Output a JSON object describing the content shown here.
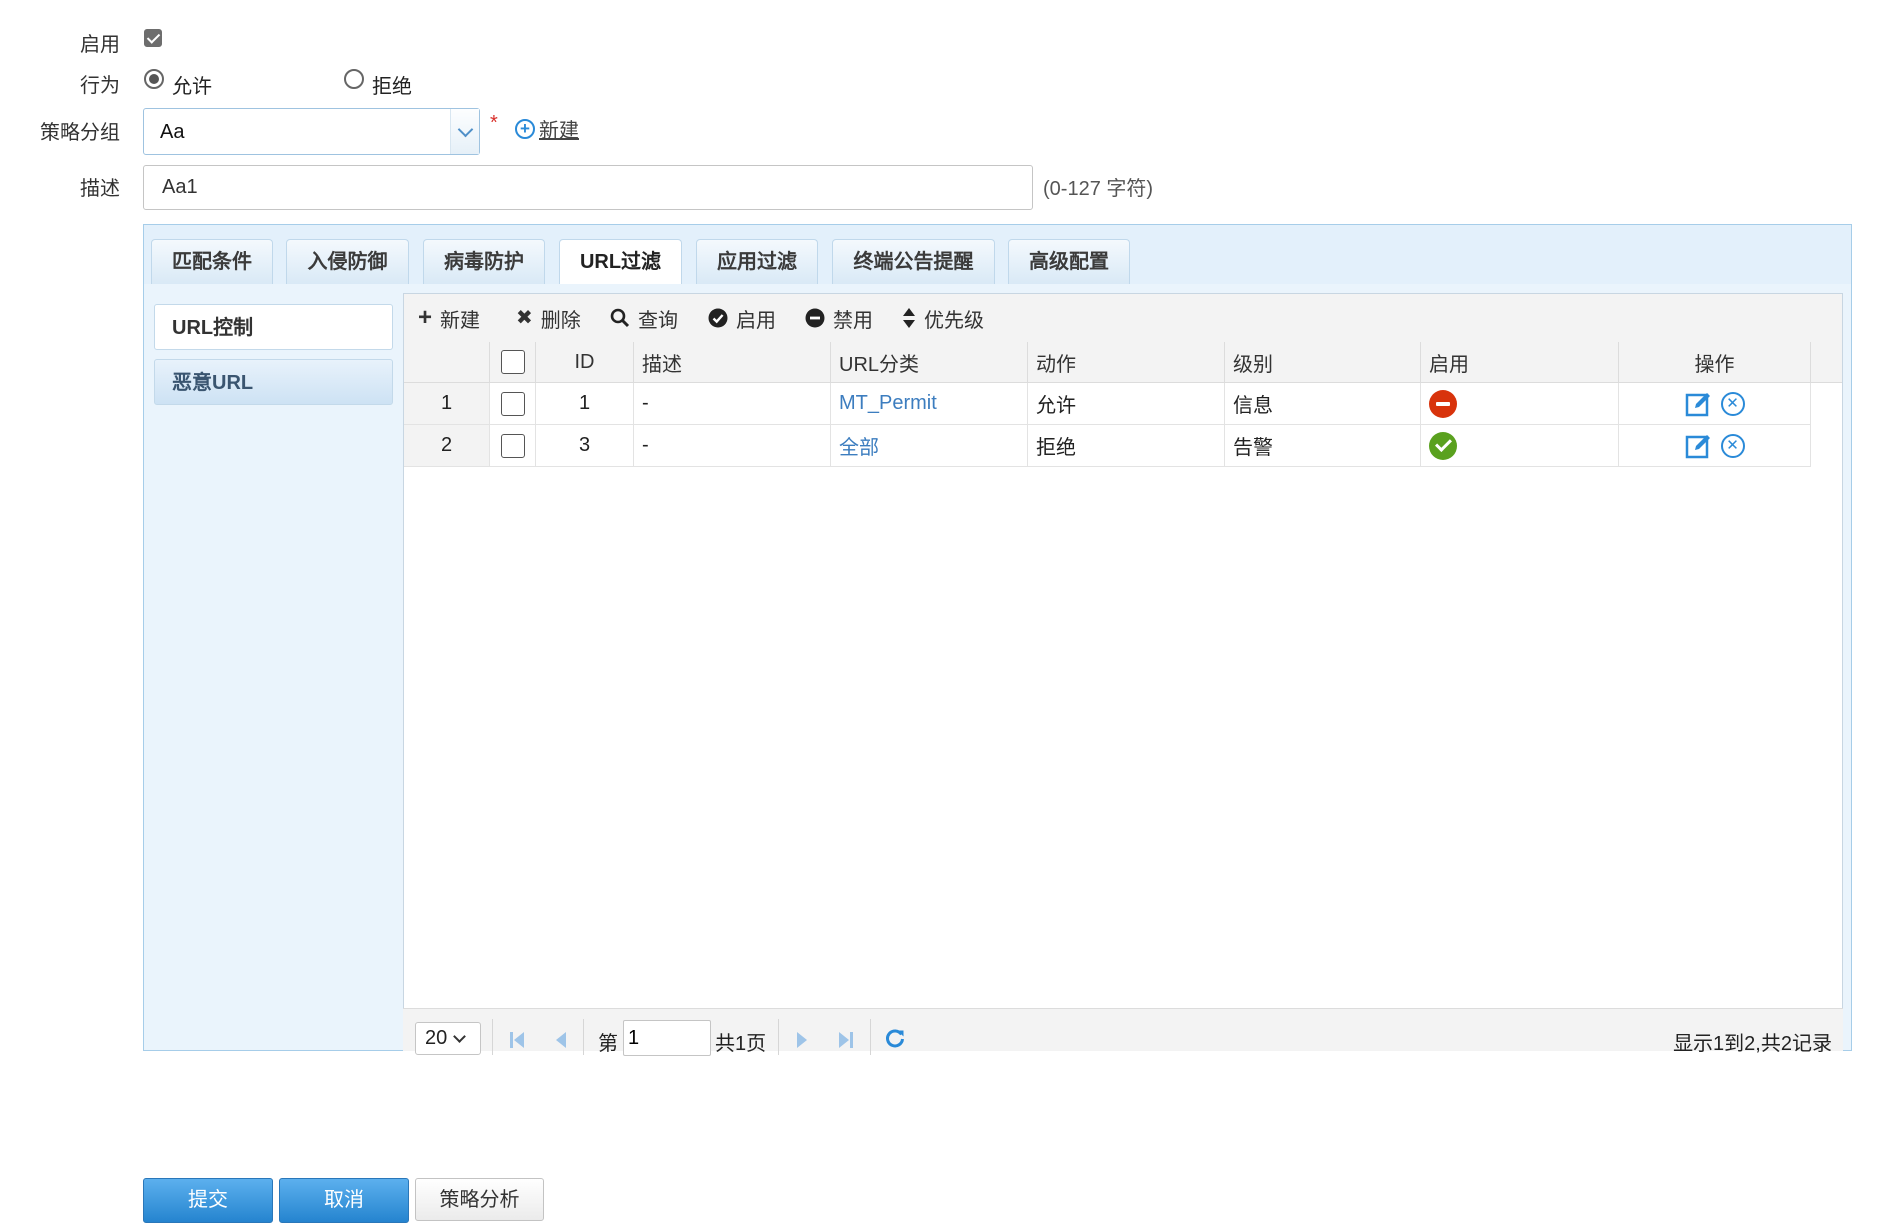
{
  "form": {
    "enable_label": "启用",
    "enable_checked": true,
    "action_label": "行为",
    "action_options": [
      "允许",
      "拒绝"
    ],
    "action_selected": "允许",
    "group_label": "策略分组",
    "group_value": "Aa",
    "required_mark": "*",
    "new_link": "新建",
    "desc_label": "描述",
    "desc_value": "Aa1",
    "desc_hint": "(0-127 字符)"
  },
  "tabs": [
    "匹配条件",
    "入侵防御",
    "病毒防护",
    "URL过滤",
    "应用过滤",
    "终端公告提醒",
    "高级配置"
  ],
  "active_tab": "URL过滤",
  "side_menu": [
    "URL控制",
    "恶意URL"
  ],
  "active_side": "恶意URL",
  "toolbar": {
    "new": "新建",
    "delete": "删除",
    "query": "查询",
    "enable": "启用",
    "disable": "禁用",
    "priority": "优先级"
  },
  "table": {
    "headers": [
      "ID",
      "描述",
      "URL分类",
      "动作",
      "级别",
      "启用",
      "操作"
    ],
    "rows": [
      {
        "num": "1",
        "id": "1",
        "desc": "-",
        "url_category": "MT_Permit",
        "action": "允许",
        "level": "信息",
        "enabled": false
      },
      {
        "num": "2",
        "id": "3",
        "desc": "-",
        "url_category": "全部",
        "action": "拒绝",
        "level": "告警",
        "enabled": true
      }
    ]
  },
  "pager": {
    "page_size": "20",
    "page_prefix": "第",
    "page_value": "1",
    "page_total": "共1页",
    "summary": "显示1到2,共2记录"
  },
  "buttons": {
    "submit": "提交",
    "cancel": "取消",
    "analyze": "策略分析"
  },
  "colors": {
    "accent": "#2584cf",
    "link": "#3c7dbf",
    "disabled_status": "#d8330c",
    "enabled_status": "#5aa11f",
    "required": "#d9302b"
  },
  "icons": {
    "new": "plus-icon",
    "delete": "cross-icon",
    "query": "search-icon",
    "enable": "check-circle-icon",
    "disable": "minus-circle-icon",
    "priority": "sort-icon",
    "edit": "edit-icon",
    "remove": "close-circle-icon"
  }
}
